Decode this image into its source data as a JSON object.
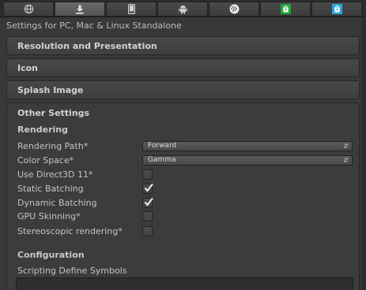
{
  "platform_tabs": [
    {
      "icon": "globe-icon",
      "active": false
    },
    {
      "icon": "download-icon",
      "active": true
    },
    {
      "icon": "mobile-phone-icon",
      "active": false
    },
    {
      "icon": "android-icon",
      "active": false
    },
    {
      "icon": "blackberry-icon",
      "active": false
    },
    {
      "icon": "windows-store-green-icon",
      "color": "#1fa834",
      "active": false
    },
    {
      "icon": "windows-store-blue-icon",
      "color": "#29a8e0",
      "active": false
    }
  ],
  "settings_title": "Settings for PC, Mac & Linux Standalone",
  "sections": {
    "resolution": "Resolution and Presentation",
    "icon": "Icon",
    "splash": "Splash Image",
    "other": "Other Settings"
  },
  "rendering": {
    "heading": "Rendering",
    "rendering_path_label": "Rendering Path*",
    "rendering_path_value": "Forward",
    "color_space_label": "Color Space*",
    "color_space_value": "Gamma",
    "direct3d_label": "Use Direct3D 11*",
    "direct3d_checked": false,
    "static_batching_label": "Static Batching",
    "static_batching_checked": true,
    "dynamic_batching_label": "Dynamic Batching",
    "dynamic_batching_checked": true,
    "gpu_skinning_label": "GPU Skinning*",
    "gpu_skinning_checked": false,
    "stereo_label": "Stereoscopic rendering*",
    "stereo_checked": false
  },
  "configuration": {
    "heading": "Configuration",
    "scripting_define_label": "Scripting Define Symbols",
    "scripting_define_value": ""
  }
}
